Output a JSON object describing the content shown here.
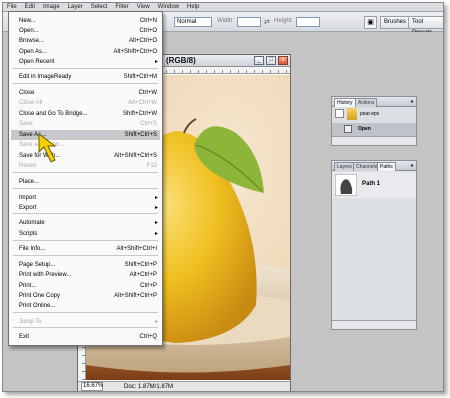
{
  "menubar": [
    "File",
    "Edit",
    "Image",
    "Layer",
    "Select",
    "Filter",
    "View",
    "Window",
    "Help"
  ],
  "options_bar": {
    "style_value": "Normal",
    "width_label": "Width:",
    "height_label": "Height:",
    "swap_symbol": "⇄",
    "tabs": [
      "Brushes",
      "Tool Presets"
    ]
  },
  "document": {
    "title": "(RGB/8)",
    "zoom": "16.67%",
    "doc_info": "Doc: 1.87M/1.87M",
    "buttons": [
      "_",
      "□",
      "x"
    ]
  },
  "history_palette": {
    "tabs": [
      "History",
      "Actions"
    ],
    "snapshot_name": "pear.eps",
    "state_name": "Open"
  },
  "paths_palette": {
    "tabs": [
      "Layers",
      "Channels",
      "Paths"
    ],
    "path_name": "Path 1"
  },
  "file_menu": {
    "items": [
      {
        "label": "New...",
        "shortcut": "Ctrl+N"
      },
      {
        "label": "Open...",
        "shortcut": "Ctrl+O"
      },
      {
        "label": "Browse...",
        "shortcut": "Alt+Ctrl+O"
      },
      {
        "label": "Open As...",
        "shortcut": "Alt+Shift+Ctrl+O"
      },
      {
        "label": "Open Recent",
        "shortcut": "",
        "submenu": true
      },
      {
        "label": "Edit in ImageReady",
        "shortcut": "Shift+Ctrl+M"
      },
      {
        "label": "Close",
        "shortcut": "Ctrl+W"
      },
      {
        "label": "Close All",
        "shortcut": "Alt+Ctrl+W",
        "disabled": true
      },
      {
        "label": "Close and Go To Bridge...",
        "shortcut": "Shift+Ctrl+W"
      },
      {
        "label": "Save",
        "shortcut": "Ctrl+S",
        "disabled": true
      },
      {
        "label": "Save As...",
        "shortcut": "Shift+Ctrl+S",
        "highlighted": true
      },
      {
        "label": "Save a Version...",
        "shortcut": "",
        "disabled": true
      },
      {
        "label": "Save for Web...",
        "shortcut": "Alt+Shift+Ctrl+S"
      },
      {
        "label": "Revert",
        "shortcut": "F12",
        "disabled": true
      },
      {
        "label": "Place...",
        "shortcut": ""
      },
      {
        "label": "Import",
        "shortcut": "",
        "submenu": true
      },
      {
        "label": "Export",
        "shortcut": "",
        "submenu": true
      },
      {
        "label": "Automate",
        "shortcut": "",
        "submenu": true
      },
      {
        "label": "Scripts",
        "shortcut": "",
        "submenu": true
      },
      {
        "label": "File Info...",
        "shortcut": "Alt+Shift+Ctrl+I"
      },
      {
        "label": "Page Setup...",
        "shortcut": "Shift+Ctrl+P"
      },
      {
        "label": "Print with Preview...",
        "shortcut": "Alt+Ctrl+P"
      },
      {
        "label": "Print...",
        "shortcut": "Ctrl+P"
      },
      {
        "label": "Print One Copy",
        "shortcut": "Alt+Shift+Ctrl+P"
      },
      {
        "label": "Print Online...",
        "shortcut": ""
      },
      {
        "label": "Jump To",
        "shortcut": "",
        "submenu": true,
        "disabled": true
      },
      {
        "label": "Exit",
        "shortcut": "Ctrl+Q"
      }
    ],
    "submenu_arrow": "▸"
  },
  "colors": {
    "menu_highlight": "#c7c7cc",
    "disabled_text": "#a8a8a8",
    "close_button": "#d8583a",
    "pear_yellow": "#f0c020",
    "leaf_green": "#8db53a"
  }
}
